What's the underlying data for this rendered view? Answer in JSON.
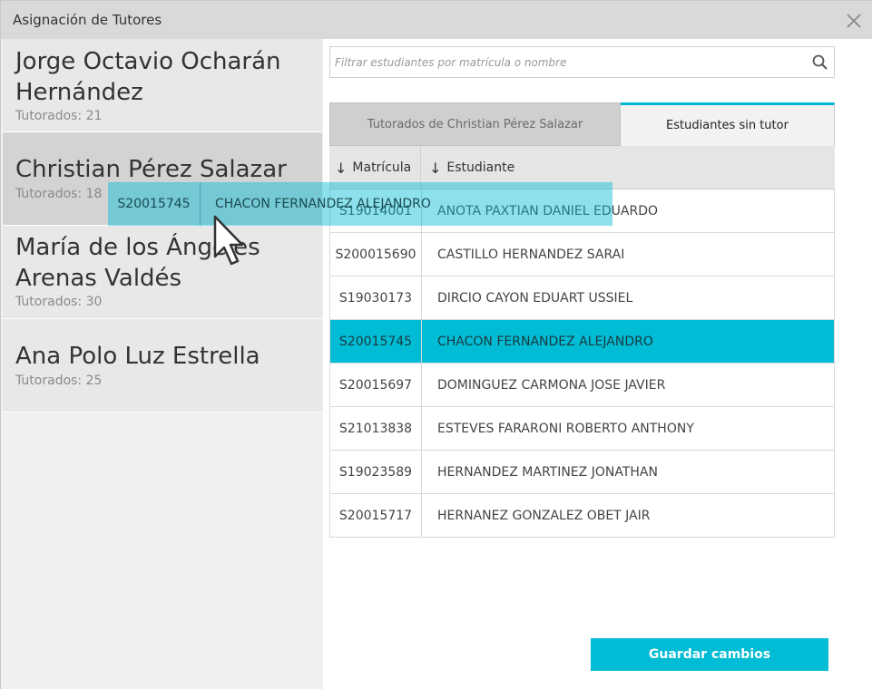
{
  "window": {
    "title": "Asignación de Tutores",
    "close_icon": "close-icon"
  },
  "sidebar": {
    "tutors": [
      {
        "name_line1": "Jorge Octavio Ocharán",
        "name_line2": "Hernández",
        "count": "Tutorados: 21"
      },
      {
        "name_line1": "Christian Pérez Salazar",
        "name_line2": "",
        "count": "Tutorados: 18"
      },
      {
        "name_line1": "María de los Ángeles",
        "name_line2": "Arenas Valdés",
        "count": "Tutorados: 30"
      },
      {
        "name_line1": "Ana Polo Luz Estrella",
        "name_line2": "",
        "count": "Tutorados: 25"
      }
    ],
    "selected_index": 1
  },
  "search": {
    "placeholder": "Filtrar estudiantes por matrícula o nombre",
    "value": "",
    "icon": "search-icon"
  },
  "tabs": [
    {
      "label": "Tutorados de Christian Pérez Salazar",
      "active": false
    },
    {
      "label": "Estudiantes sin tutor",
      "active": true
    }
  ],
  "table": {
    "columns": [
      {
        "label": "Matrícula",
        "sort_icon": "arrow-down-icon"
      },
      {
        "label": "Estudiante",
        "sort_icon": "arrow-down-icon"
      }
    ],
    "rows": [
      {
        "id": "S19014001",
        "name": "ANOTA PAXTIAN DANIEL EDUARDO"
      },
      {
        "id": "S200015690",
        "name": "CASTILLO HERNANDEZ SARAI"
      },
      {
        "id": "S19030173",
        "name": "DIRCIO CAYON EDUART USSIEL"
      },
      {
        "id": "S20015745",
        "name": "CHACON FERNANDEZ ALEJANDRO"
      },
      {
        "id": "S20015697",
        "name": "DOMINGUEZ CARMONA JOSE JAVIER"
      },
      {
        "id": "S21013838",
        "name": "ESTEVES FARARONI ROBERTO ANTHONY"
      },
      {
        "id": "S19023589",
        "name": "HERNANDEZ MARTINEZ JONATHAN"
      },
      {
        "id": "S20015717",
        "name": "HERNANEZ GONZALEZ OBET JAIR"
      }
    ],
    "selected_index": 3
  },
  "drag": {
    "id": "S20015745",
    "name": "CHACON FERNANDEZ ALEJANDRO"
  },
  "actions": {
    "save_label": "Guardar cambios"
  },
  "colors": {
    "accent": "#00bcd4",
    "titlebar": "#d9d9d9",
    "sidebar_selected": "#d3d3d3"
  }
}
